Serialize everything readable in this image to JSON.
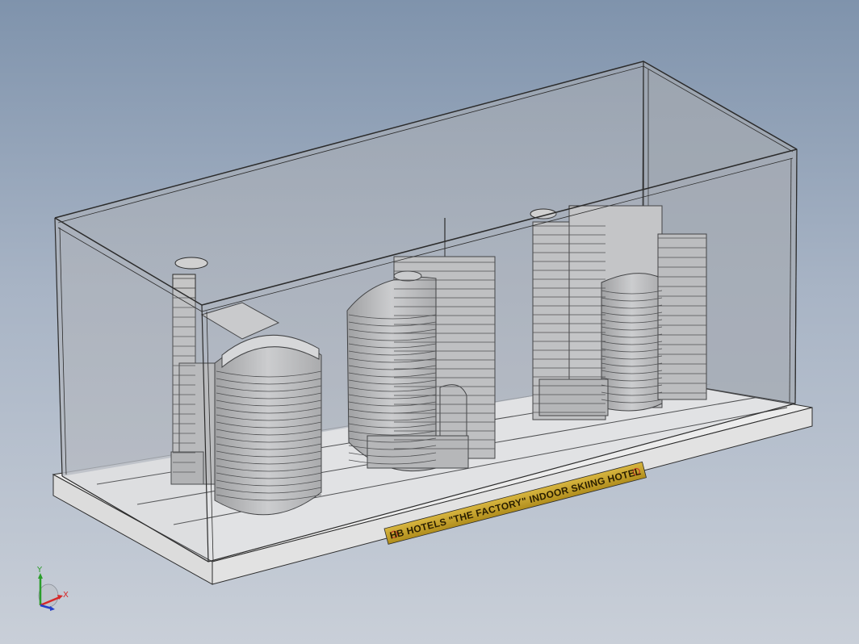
{
  "scene": {
    "plaque_text": "HB HOTELS \"THE FACTORY\" INDOOR SKIING HOTEL",
    "colors": {
      "background_top": "#7f93ac",
      "background_bottom": "#c9cfd8",
      "base": "#e6e6e6",
      "glass": "#a6acb5",
      "building": "#c9c9c9",
      "line": "#2b2b2b",
      "plaque": "#c9a227"
    }
  },
  "triad": {
    "x_label": "X",
    "y_label": "Y",
    "x_color": "#d62828",
    "y_color": "#2a9d2a",
    "z_color": "#2540c8"
  }
}
